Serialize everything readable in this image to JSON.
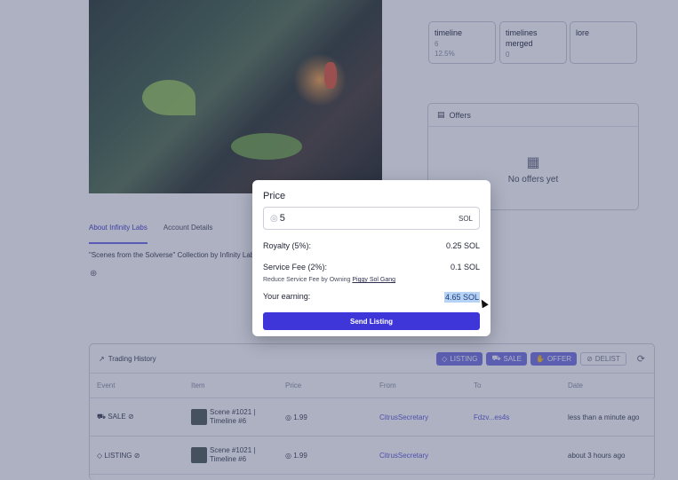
{
  "attributes": [
    {
      "trait": "timeline",
      "value": "6",
      "pct": "12.5%"
    },
    {
      "trait": "timelines merged",
      "value": "0",
      "pct": ""
    },
    {
      "trait": "lore",
      "value": "",
      "pct": ""
    }
  ],
  "offers": {
    "title": "Offers",
    "empty": "No offers yet"
  },
  "tabs": {
    "about": "About Infinity Labs",
    "account": "Account Details"
  },
  "collection_text": "\"Scenes from the Solverse\" Collection by Infinity Labs",
  "trading": {
    "title": "Trading History",
    "filters": {
      "listing": "LISTING",
      "sale": "SALE",
      "offer": "OFFER",
      "delist": "DELIST"
    },
    "columns": [
      "Event",
      "Item",
      "Price",
      "From",
      "To",
      "Date"
    ],
    "rows": [
      {
        "event": "SALE",
        "item_line1": "Scene #1021 |",
        "item_line2": "Timeline #6",
        "price": "1.99",
        "from": "CitrusSecretary",
        "to": "Fdzv...es4s",
        "date": "less than a minute ago"
      },
      {
        "event": "LISTING",
        "item_line1": "Scene #1021 |",
        "item_line2": "Timeline #6",
        "price": "1.99",
        "from": "CitrusSecretary",
        "to": "",
        "date": "about 3 hours ago"
      }
    ]
  },
  "modal": {
    "title": "Price",
    "price_value": "5",
    "price_unit": "SOL",
    "royalty_label": "Royalty (5%):",
    "royalty_value": "0.25 SOL",
    "fee_label": "Service Fee (2%):",
    "fee_value": "0.1 SOL",
    "fee_note_prefix": "Reduce Service Fee by Owning",
    "fee_note_link": "Piggy Sol Gang",
    "earning_label": "Your earning:",
    "earning_value": "4.65 SOL",
    "send_label": "Send Listing"
  },
  "colors": {
    "accent": "#3f36d9",
    "filter": "#7472e2",
    "highlight": "#b6d3f5"
  }
}
